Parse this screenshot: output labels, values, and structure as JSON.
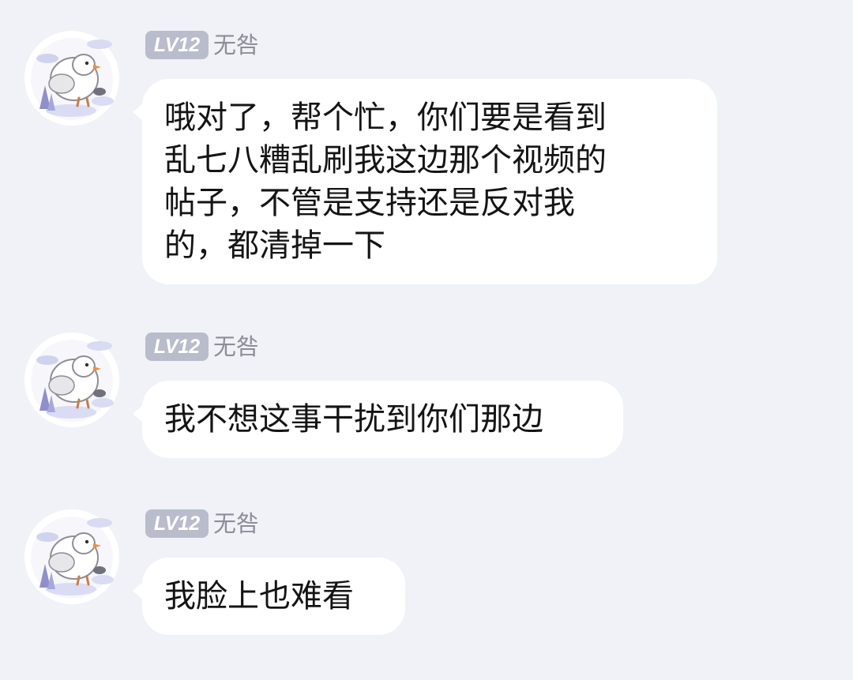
{
  "sender": {
    "level_badge": "LV12",
    "name": "无咎"
  },
  "messages": [
    {
      "lines": [
        "哦对了，帮个忙，你们要是看到",
        "乱七八糟乱刷我这边那个视频的",
        "帖子，不管是支持还是反对我",
        "的，都清掉一下"
      ]
    },
    {
      "lines": [
        "我不想这事干扰到你们那边"
      ]
    },
    {
      "lines": [
        "我脸上也难看"
      ]
    }
  ],
  "colors": {
    "background": "#f1f2f7",
    "bubble": "#ffffff",
    "level_badge": "#b9bccb",
    "username": "#8c8e98",
    "text": "#141414"
  },
  "icons": {
    "avatar": "white-pigeon-avatar-icon"
  }
}
